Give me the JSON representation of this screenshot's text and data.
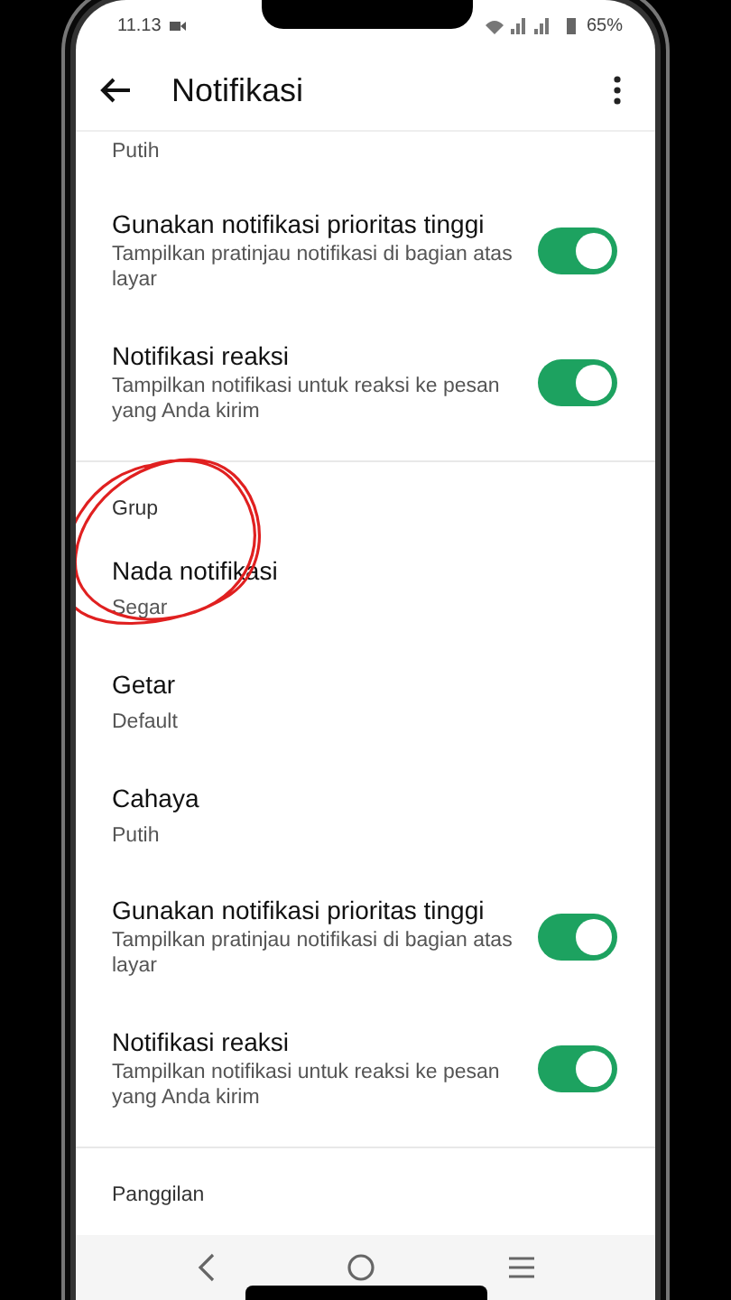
{
  "status_bar": {
    "time": "11.13",
    "battery": "65%"
  },
  "app_bar": {
    "title": "Notifikasi"
  },
  "sections": [
    {
      "items": [
        {
          "kind": "value",
          "value": "Putih"
        },
        {
          "kind": "toggle",
          "title": "Gunakan notifikasi prioritas tinggi",
          "subtitle": "Tampilkan pratinjau notifikasi di bagian atas layar",
          "on": true
        },
        {
          "kind": "toggle",
          "title": "Notifikasi reaksi",
          "subtitle": "Tampilkan notifikasi untuk reaksi ke pesan yang Anda kirim",
          "on": true
        }
      ]
    },
    {
      "header": "Grup",
      "items": [
        {
          "kind": "value",
          "title": "Nada notifikasi",
          "value": "Segar"
        },
        {
          "kind": "value",
          "title": "Getar",
          "value": "Default"
        },
        {
          "kind": "value",
          "title": "Cahaya",
          "value": "Putih"
        },
        {
          "kind": "toggle",
          "title": "Gunakan notifikasi prioritas tinggi",
          "subtitle": "Tampilkan pratinjau notifikasi di bagian atas layar",
          "on": true
        },
        {
          "kind": "toggle",
          "title": "Notifikasi reaksi",
          "subtitle": "Tampilkan notifikasi untuk reaksi ke pesan yang Anda kirim",
          "on": true
        }
      ]
    },
    {
      "header": "Panggilan"
    }
  ]
}
